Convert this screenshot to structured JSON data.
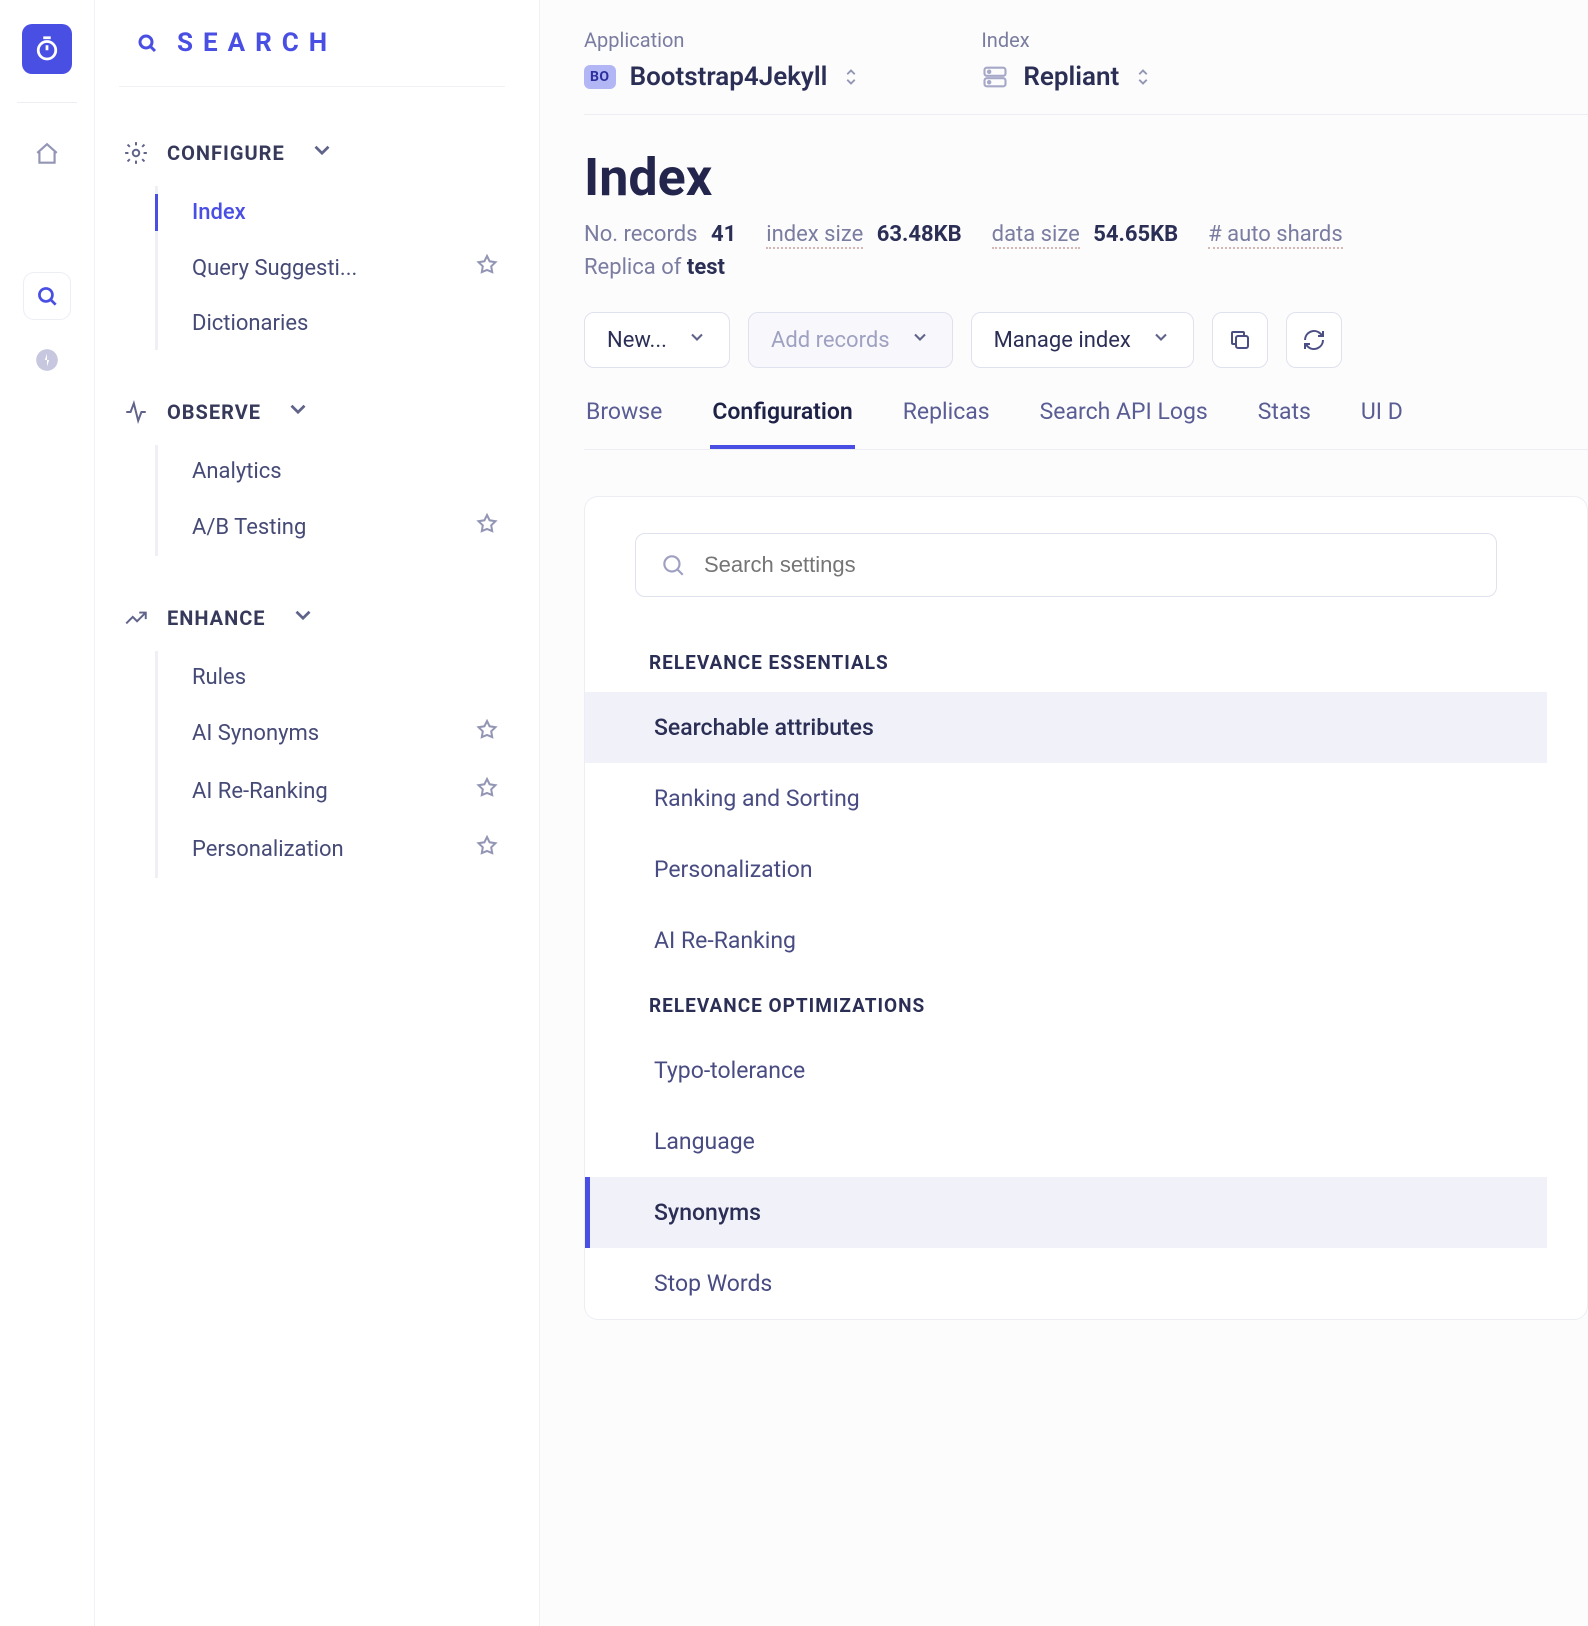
{
  "brand": "SEARCH",
  "selectors": {
    "application": {
      "label": "Application",
      "chip": "BO",
      "value": "Bootstrap4Jekyll"
    },
    "index": {
      "label": "Index",
      "value": "Repliant"
    }
  },
  "page_title": "Index",
  "stats": {
    "records": {
      "label": "No. records",
      "value": "41"
    },
    "index_size": {
      "label": "index size",
      "value": "63.48KB"
    },
    "data_size": {
      "label": "data size",
      "value": "54.65KB"
    },
    "auto_shards": {
      "label": "# auto shards"
    }
  },
  "replica": {
    "prefix": "Replica of ",
    "name": "test"
  },
  "buttons": {
    "new": "New...",
    "add_records": "Add records",
    "manage": "Manage index"
  },
  "tabs": [
    "Browse",
    "Configuration",
    "Replicas",
    "Search API Logs",
    "Stats",
    "UI D"
  ],
  "search_placeholder": "Search settings",
  "config": {
    "sections": [
      {
        "label": "RELEVANCE ESSENTIALS",
        "items": [
          "Searchable attributes",
          "Ranking and Sorting",
          "Personalization",
          "AI Re-Ranking"
        ]
      },
      {
        "label": "RELEVANCE OPTIMIZATIONS",
        "items": [
          "Typo-tolerance",
          "Language",
          "Synonyms",
          "Stop Words"
        ]
      }
    ]
  },
  "sidebar": {
    "groups": [
      {
        "label": "CONFIGURE",
        "items": [
          {
            "label": "Index",
            "starred": false,
            "active": true
          },
          {
            "label": "Query Suggesti...",
            "starred": true
          },
          {
            "label": "Dictionaries",
            "starred": false
          }
        ]
      },
      {
        "label": "OBSERVE",
        "items": [
          {
            "label": "Analytics",
            "starred": false
          },
          {
            "label": "A/B Testing",
            "starred": true
          }
        ]
      },
      {
        "label": "ENHANCE",
        "items": [
          {
            "label": "Rules",
            "starred": false
          },
          {
            "label": "AI Synonyms",
            "starred": true
          },
          {
            "label": "AI Re-Ranking",
            "starred": true
          },
          {
            "label": "Personalization",
            "starred": true
          }
        ]
      }
    ]
  }
}
